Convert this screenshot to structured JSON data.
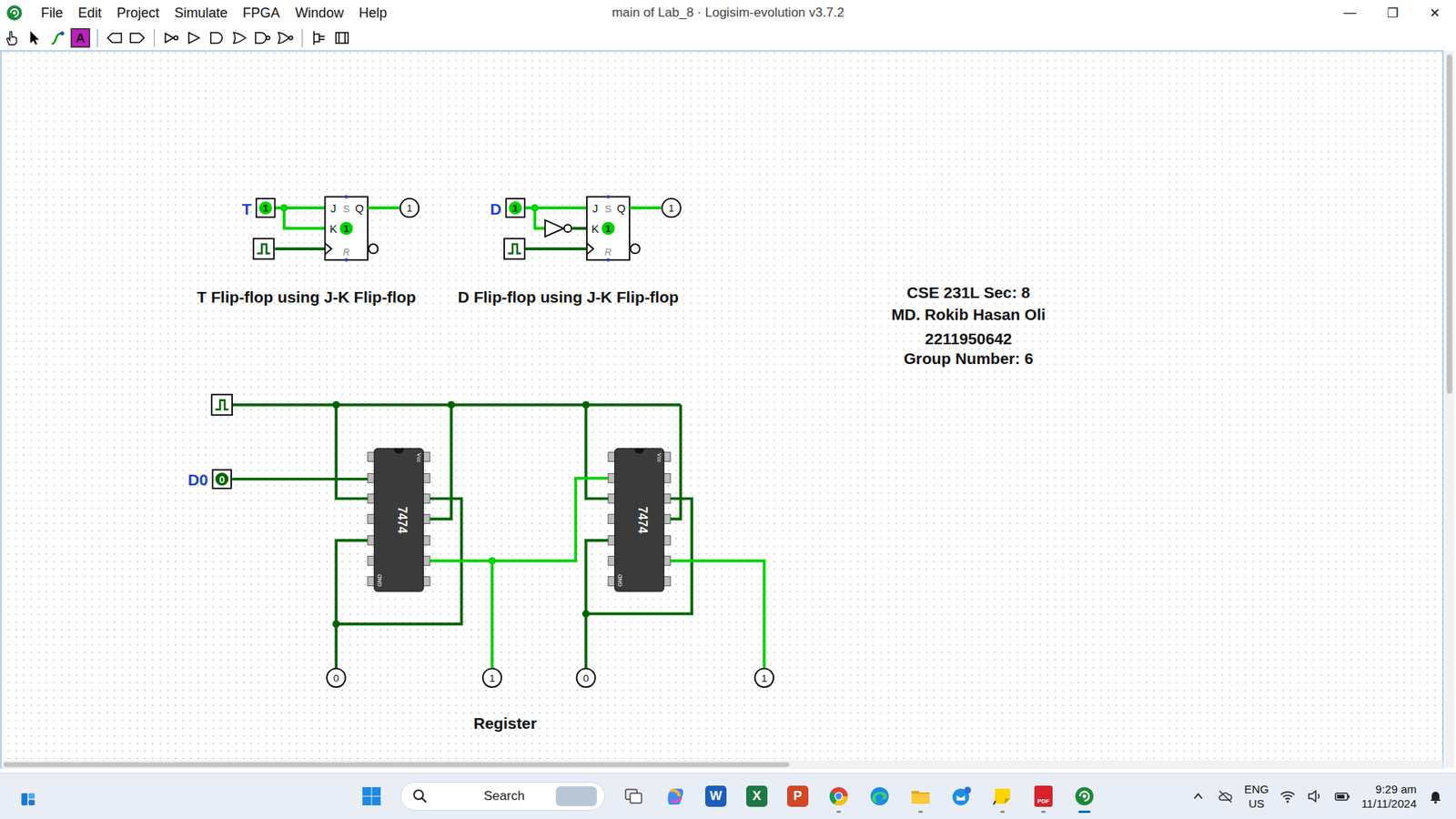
{
  "window": {
    "title": "main of Lab_8 · Logisim-evolution v3.7.2",
    "controls": [
      "—",
      "❐",
      "✕"
    ]
  },
  "menu": [
    "File",
    "Edit",
    "Project",
    "Simulate",
    "FPGA",
    "Window",
    "Help"
  ],
  "toolbar": [
    {
      "kind": "poke",
      "selected": false
    },
    {
      "kind": "select",
      "selected": false
    },
    {
      "kind": "wire",
      "selected": false
    },
    {
      "kind": "text",
      "label": "A",
      "selected": true
    },
    {
      "kind": "separator"
    },
    {
      "kind": "pin-in",
      "selected": false
    },
    {
      "kind": "pin-out",
      "selected": false
    },
    {
      "kind": "separator"
    },
    {
      "kind": "not",
      "selected": false
    },
    {
      "kind": "buffer",
      "selected": false
    },
    {
      "kind": "and",
      "selected": false
    },
    {
      "kind": "or",
      "selected": false
    },
    {
      "kind": "nand",
      "selected": false
    },
    {
      "kind": "nor",
      "selected": false
    },
    {
      "kind": "separator"
    },
    {
      "kind": "splitter",
      "selected": false
    },
    {
      "kind": "tunnel",
      "selected": false
    }
  ],
  "jk_pins": [
    "J",
    "S",
    "Q",
    "K",
    "R"
  ],
  "t_ff": {
    "caption": "T Flip-flop using J-K Flip-flop",
    "input_label": "T",
    "input_value": "1",
    "clock_on": false,
    "state": "1",
    "output": "1"
  },
  "d_ff": {
    "caption": "D Flip-flop using J-K Flip-flop",
    "input_label": "D",
    "input_value": "1",
    "clock_on": false,
    "state": "1",
    "output": "1"
  },
  "author": [
    "CSE 231L Sec: 8",
    "MD. Rokib Hasan Oli",
    "2211950642",
    "Group Number: 6"
  ],
  "register": {
    "caption": "Register",
    "clock_on": false,
    "input": {
      "label": "D0",
      "value": "0"
    },
    "chips": [
      {
        "label": "7474",
        "vcc": "Vcc",
        "gnd": "GND"
      },
      {
        "label": "7474",
        "vcc": "Vcc",
        "gnd": "GND"
      }
    ],
    "outputs": [
      "0",
      "1",
      "0",
      "1"
    ]
  },
  "taskbar": {
    "search": "Search",
    "apps": [
      {
        "kind": "task-view",
        "running": false,
        "active": false
      },
      {
        "kind": "copilot",
        "running": false,
        "active": false
      },
      {
        "kind": "word",
        "glyph": "W",
        "running": false,
        "active": false
      },
      {
        "kind": "excel",
        "glyph": "X",
        "running": false,
        "active": false
      },
      {
        "kind": "powerpoint",
        "glyph": "P",
        "running": false,
        "active": false
      },
      {
        "kind": "chrome",
        "running": true,
        "active": false
      },
      {
        "kind": "edge",
        "running": false,
        "active": false
      },
      {
        "kind": "explorer",
        "running": true,
        "active": false
      },
      {
        "kind": "mail",
        "running": false,
        "active": false
      },
      {
        "kind": "sticky",
        "running": true,
        "active": false
      },
      {
        "kind": "pdf",
        "glyph": "PDF",
        "running": true,
        "active": false
      },
      {
        "kind": "logisim",
        "running": true,
        "active": true
      }
    ],
    "lang": [
      "ENG",
      "US"
    ],
    "time": "9:29 am",
    "date": "11/11/2024"
  }
}
